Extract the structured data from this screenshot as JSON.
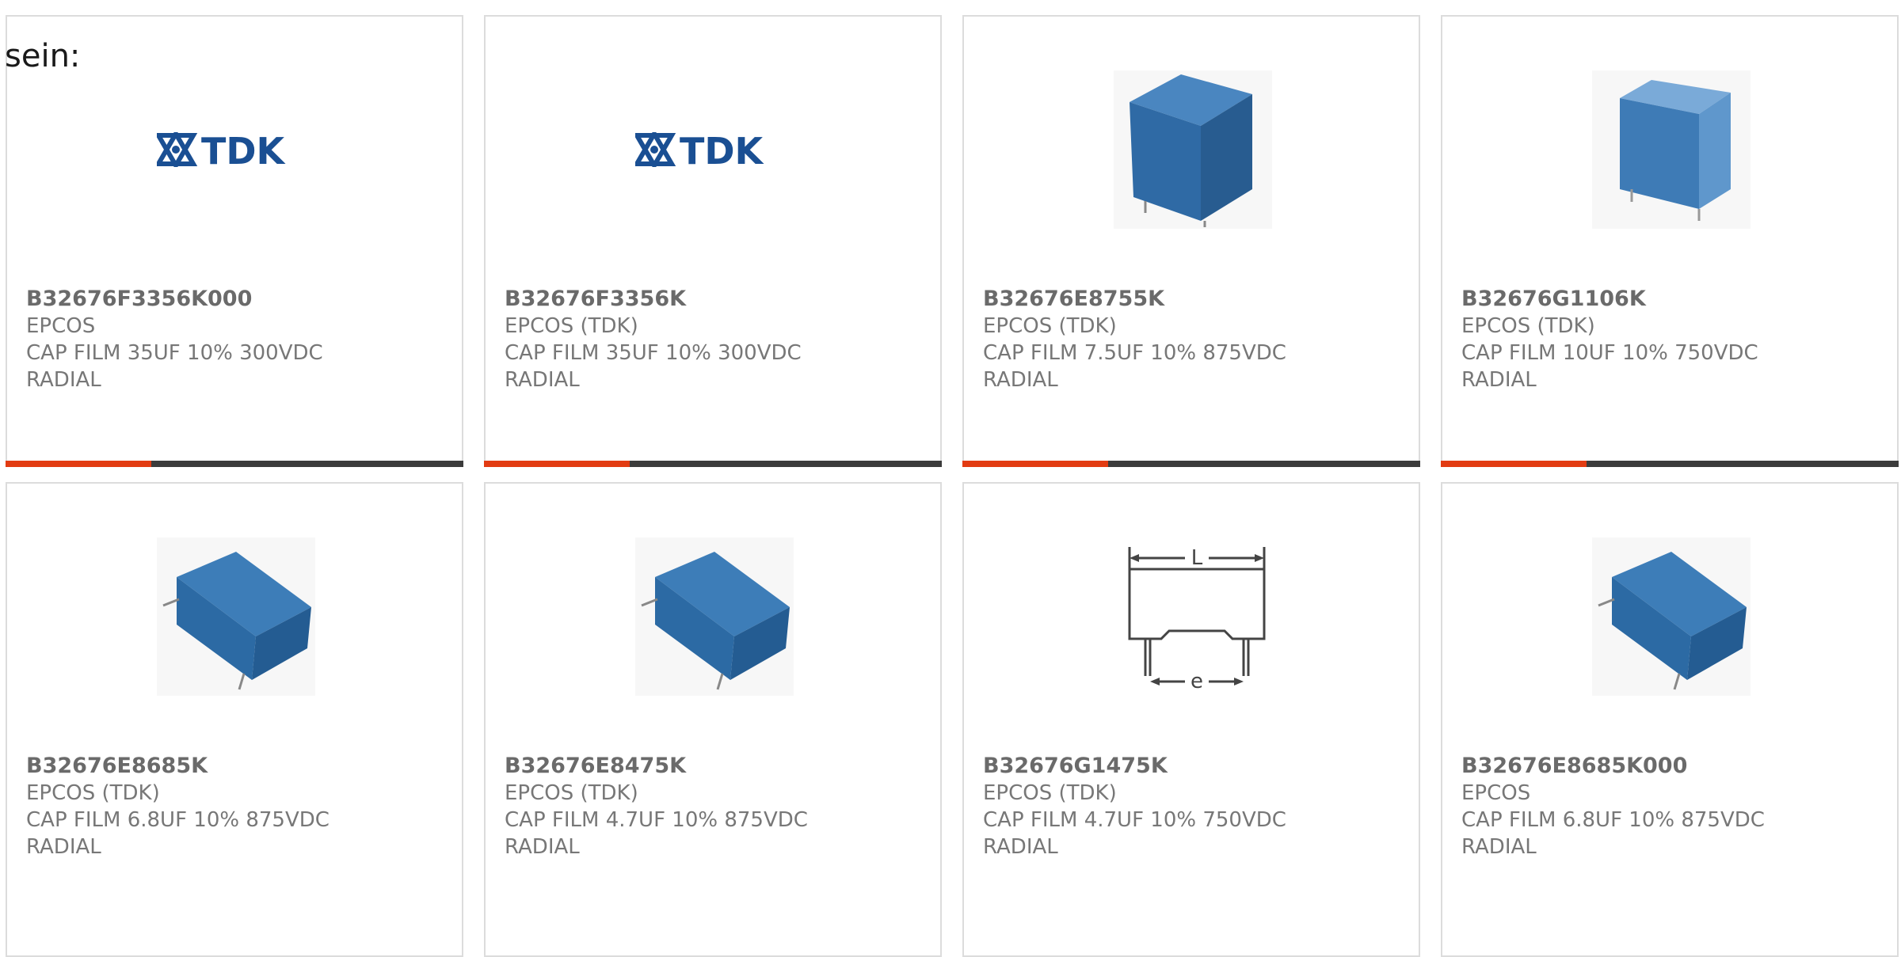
{
  "lead_text": "sein:",
  "colors": {
    "accent": "#e23b12",
    "bar": "#3b3b3b",
    "tdk_blue": "#1a4f93",
    "capacitor_blue": "#3b79b6"
  },
  "products": [
    {
      "part": "B32676F3356K000",
      "maker": "EPCOS",
      "desc": "CAP FILM 35UF 10% 300VDC",
      "pkg": "RADIAL",
      "image": "tdk-logo"
    },
    {
      "part": "B32676F3356K",
      "maker": "EPCOS (TDK)",
      "desc": "CAP FILM 35UF 10% 300VDC",
      "pkg": "RADIAL",
      "image": "tdk-logo"
    },
    {
      "part": "B32676E8755K",
      "maker": "EPCOS (TDK)",
      "desc": "CAP FILM 7.5UF 10% 875VDC",
      "pkg": "RADIAL",
      "image": "capacitor-upright-icon"
    },
    {
      "part": "B32676G1106K",
      "maker": "EPCOS (TDK)",
      "desc": "CAP FILM 10UF 10% 750VDC",
      "pkg": "RADIAL",
      "image": "capacitor-upright-icon"
    },
    {
      "part": "B32676E8685K",
      "maker": "EPCOS (TDK)",
      "desc": "CAP FILM 6.8UF 10% 875VDC",
      "pkg": "RADIAL",
      "image": "capacitor-tilted-icon"
    },
    {
      "part": "B32676E8475K",
      "maker": "EPCOS (TDK)",
      "desc": "CAP FILM 4.7UF 10% 875VDC",
      "pkg": "RADIAL",
      "image": "capacitor-tilted-icon"
    },
    {
      "part": "B32676G1475K",
      "maker": "EPCOS (TDK)",
      "desc": "CAP FILM 4.7UF 10% 750VDC",
      "pkg": "RADIAL",
      "image": "dimension-drawing-icon",
      "drawing_labels": {
        "length": "L",
        "pitch": "e"
      }
    },
    {
      "part": "B32676E8685K000",
      "maker": "EPCOS",
      "desc": "CAP FILM 6.8UF 10% 875VDC",
      "pkg": "RADIAL",
      "image": "capacitor-tilted-icon"
    }
  ]
}
